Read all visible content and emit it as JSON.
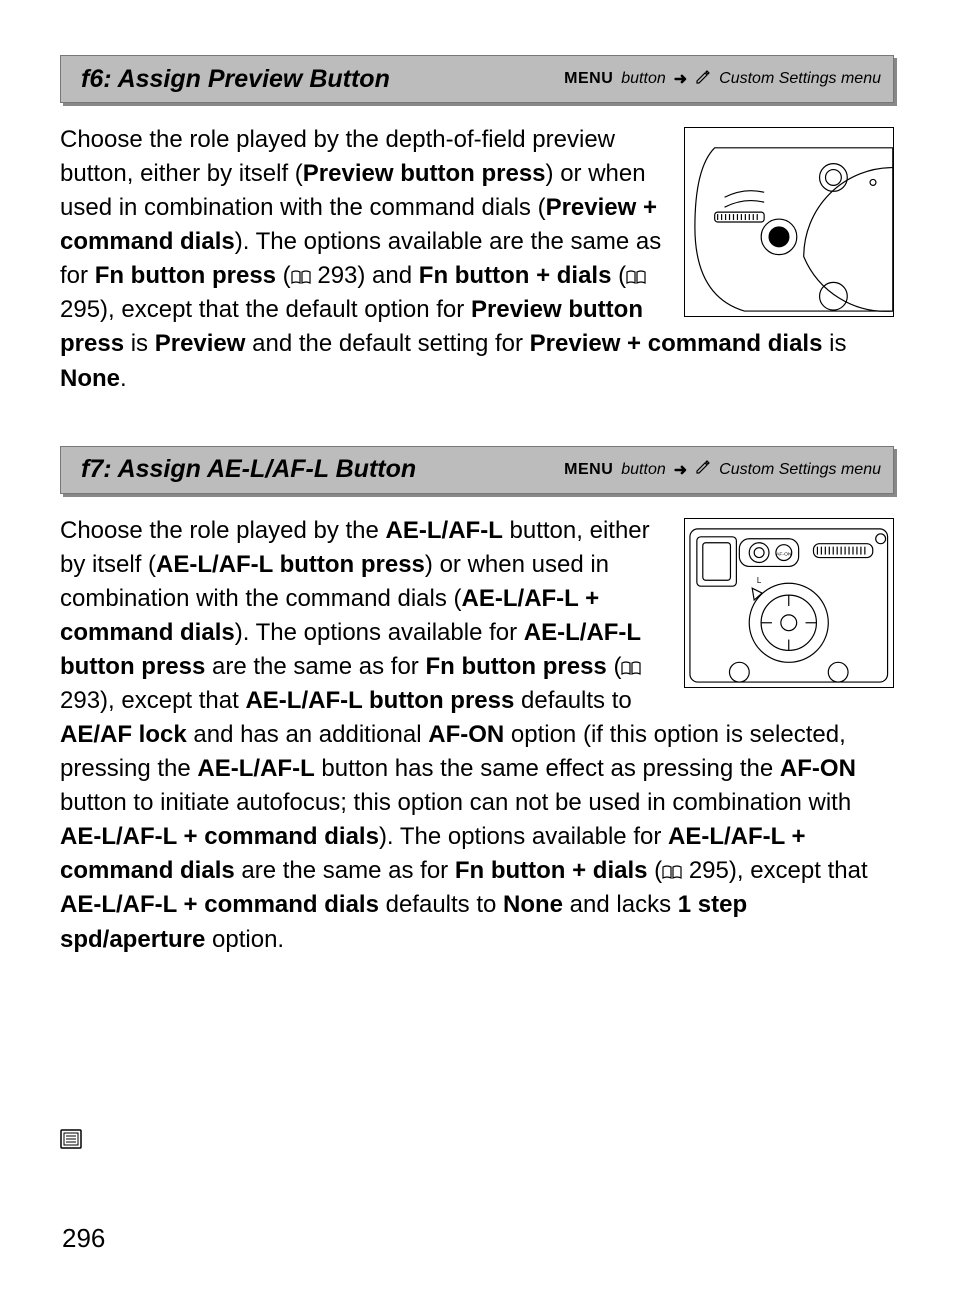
{
  "sections": [
    {
      "title": "f6: Assign Preview Button",
      "nav_menu": "MENU",
      "nav_button": "button",
      "nav_arrow": "➜",
      "nav_menu_name": "Custom Settings menu",
      "text_html": "Choose the role played by the depth-of-field preview button, either by itself (<b>Preview button press</b>) or when used in combination with the command dials (<b>Preview + command dials</b>).  The options available are the same as for <b>Fn button press</b> (<span class='bookicon'>▯</span> 293) and <b>Fn button + dials</b> (<span class='bookicon'>▯</span> 295), except that the default option for <b>Preview button press</b> is <b>Preview</b> and the default setting for <b>Preview + command dials</b> is <b>None</b>."
    },
    {
      "title": "f7: Assign AE-L/AF-L Button",
      "nav_menu": "MENU",
      "nav_button": "button",
      "nav_arrow": "➜",
      "nav_menu_name": "Custom Settings menu",
      "text_html": "Choose the role played by the <span class='smallcaps'>AE-L/AF-L</span> button, either by itself (<b>AE-L/AF-L button press</b>) or when used in combination with the command dials (<b>AE-L/AF-L + command dials</b>).  The options available for <b>AE-L/AF-L button press</b> are the same as for <b>Fn button press</b> (<span class='bookicon'>▯</span> 293), except that <b>AE-L/AF-L button press</b> defaults to <b>AE/AF lock</b> and has an additional <b>AF-ON</b> option (if this option is selected, pressing the <span class='smallcaps'>AE-L/AF-L</span> button has the same effect as pressing the <span class='smallcaps'>AF-ON</span> button to initiate autofocus; this option can not be used in combination with <b>AE-L/AF-L + command dials</b>).  The options available for <b>AE-L/AF-L + command dials</b> are the same as for <b>Fn button + dials</b> (<span class='bookicon'>▯</span> 295), except that <b>AE-L/AF-L + command dials</b> defaults to <b>None</b> and lacks <b>1 step spd/aperture</b> option."
    }
  ],
  "page_number": "296"
}
